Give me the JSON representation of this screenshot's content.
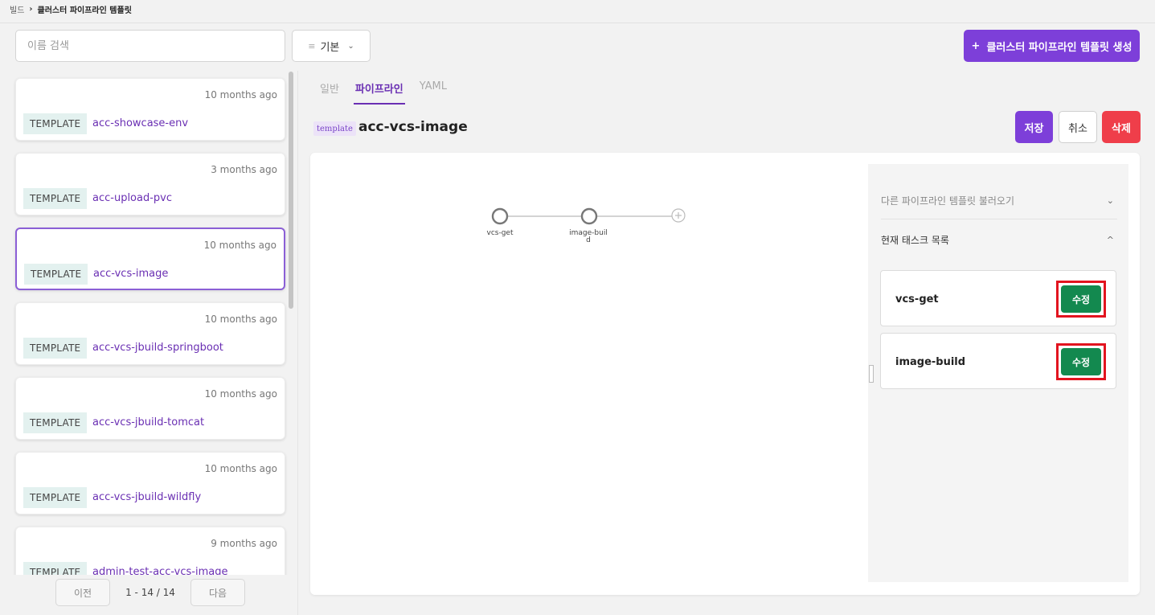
{
  "breadcrumb": {
    "root": "빌드",
    "separator": "›",
    "current": "클러스터 파이프라인 템플릿"
  },
  "search": {
    "placeholder": "이름 검색",
    "value": ""
  },
  "sort": {
    "icon": "filter-lines-icon",
    "label": "기본",
    "chevron": "⌄"
  },
  "create_button": {
    "icon": "+",
    "label": "클러스터 파이프라인 템플릿 생성"
  },
  "templates": [
    {
      "badge": "TEMPLATE",
      "name": "acc-showcase-env",
      "time": "10 months ago"
    },
    {
      "badge": "TEMPLATE",
      "name": "acc-upload-pvc",
      "time": "3 months ago"
    },
    {
      "badge": "TEMPLATE",
      "name": "acc-vcs-image",
      "time": "10 months ago",
      "selected": true
    },
    {
      "badge": "TEMPLATE",
      "name": "acc-vcs-jbuild-springboot",
      "time": "10 months ago"
    },
    {
      "badge": "TEMPLATE",
      "name": "acc-vcs-jbuild-tomcat",
      "time": "10 months ago"
    },
    {
      "badge": "TEMPLATE",
      "name": "acc-vcs-jbuild-wildfly",
      "time": "10 months ago"
    },
    {
      "badge": "TEMPLATE",
      "name": "admin-test-acc-vcs-image",
      "time": "9 months ago"
    }
  ],
  "pagination": {
    "prev": "이전",
    "info": "1 - 14 / 14",
    "next": "다음"
  },
  "detail": {
    "tabs": [
      {
        "label": "일반",
        "active": false
      },
      {
        "label": "파이프라인",
        "active": true
      },
      {
        "label": "YAML",
        "active": false
      }
    ],
    "tag": "template",
    "title": "acc-vcs-image",
    "buttons": {
      "save": "저장",
      "cancel": "취소",
      "delete": "삭제"
    }
  },
  "pipeline": {
    "nodes": [
      "vcs-get",
      "image-build"
    ],
    "add_icon": "add-circle-icon"
  },
  "side_panel": {
    "load_other": "다른 파이프라인 템플릿 불러오기",
    "task_list": "현재 태스크 목록",
    "tasks": [
      {
        "name": "vcs-get",
        "edit_label": "수정"
      },
      {
        "name": "image-build",
        "edit_label": "수정"
      }
    ]
  },
  "colors": {
    "accent": "#7d3fd9",
    "delete": "#ef3e4a",
    "edit": "#13894f",
    "highlight": "#e2141f",
    "badge_bg": "#e3f1ef"
  }
}
